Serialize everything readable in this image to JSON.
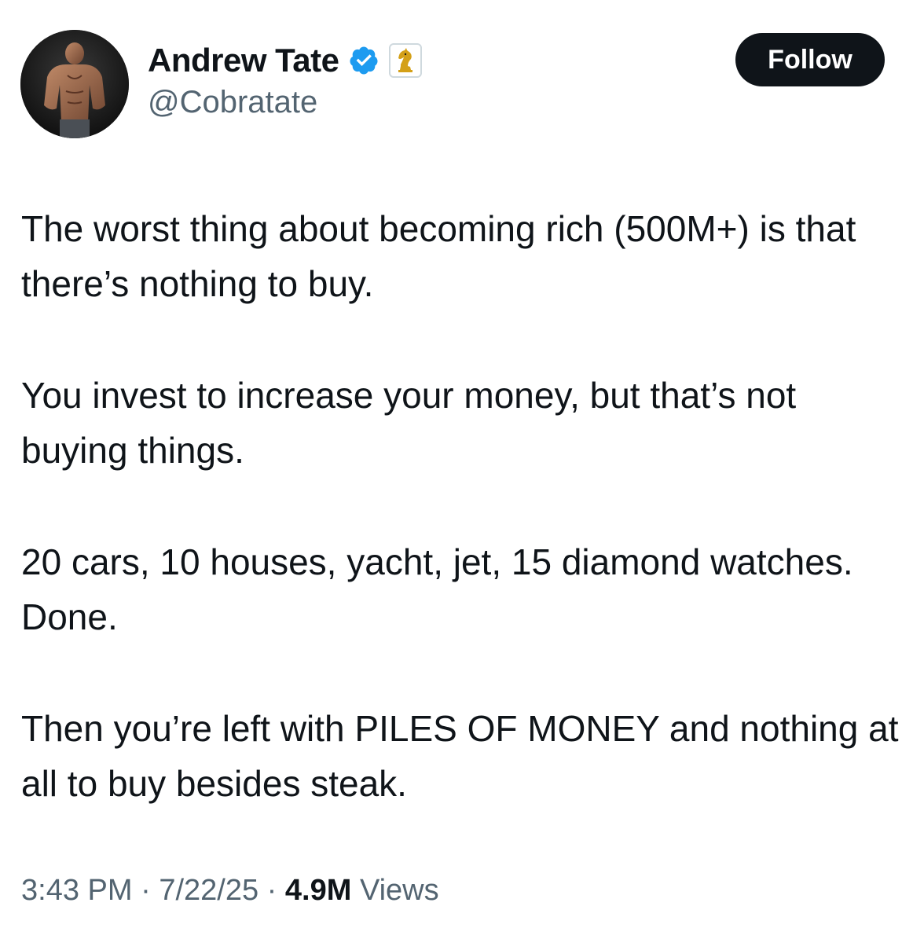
{
  "author": {
    "display_name": "Andrew Tate",
    "handle": "@Cobratate",
    "verified_badge_icon": "verified-checkmark-icon",
    "verified_color": "#1d9bf0",
    "affiliate_icon": "chess-knight-icon",
    "affiliate_color": "#d4a017"
  },
  "follow_button": {
    "label": "Follow",
    "background": "#0f1419",
    "text_color": "#ffffff"
  },
  "tweet": {
    "paragraphs": [
      "The worst thing about becoming rich (500M+) is that there’s nothing to buy.",
      "You invest to increase your money, but that’s not buying things.",
      "20 cars, 10 houses, yacht, jet, 15 diamond watches. Done.",
      "Then you’re left with PILES OF MONEY and nothing at all to buy besides steak."
    ]
  },
  "meta": {
    "time": "3:43 PM",
    "separator": "·",
    "date": "7/22/25",
    "views_count": "4.9M",
    "views_label": "Views"
  }
}
